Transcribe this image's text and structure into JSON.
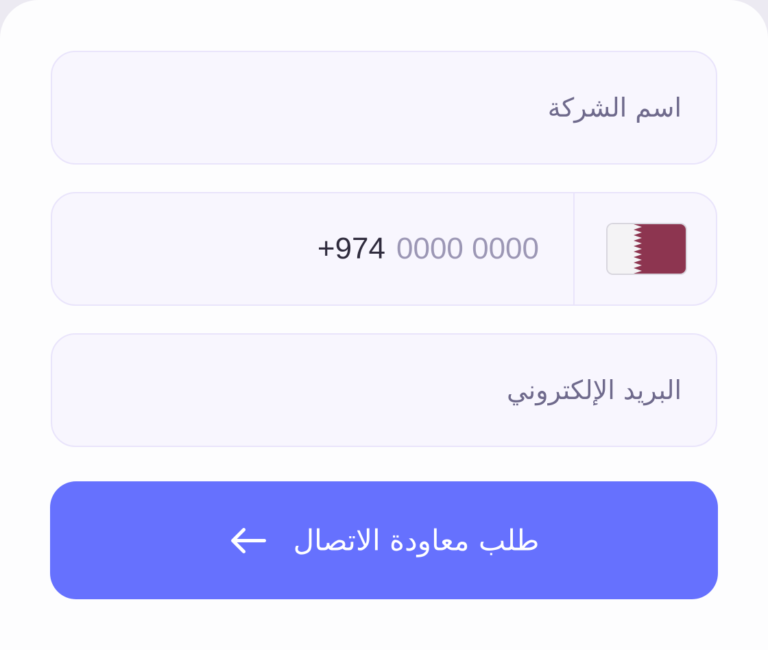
{
  "form": {
    "company_name": {
      "placeholder": "اسم الشركة"
    },
    "phone": {
      "dial_code": "+974",
      "placeholder": "0000 0000",
      "country_flag_icon": "qatar-flag-icon"
    },
    "email": {
      "placeholder": "البريد الإلكتروني"
    },
    "submit": {
      "label": "طلب معاودة الاتصال",
      "icon": "arrow-left-icon"
    }
  },
  "colors": {
    "field_background": "#f8f6fe",
    "field_border": "#e9e4fb",
    "placeholder_text": "#6f6a8c",
    "button_background": "#6671fe",
    "qatar_maroon": "#8d3550"
  }
}
